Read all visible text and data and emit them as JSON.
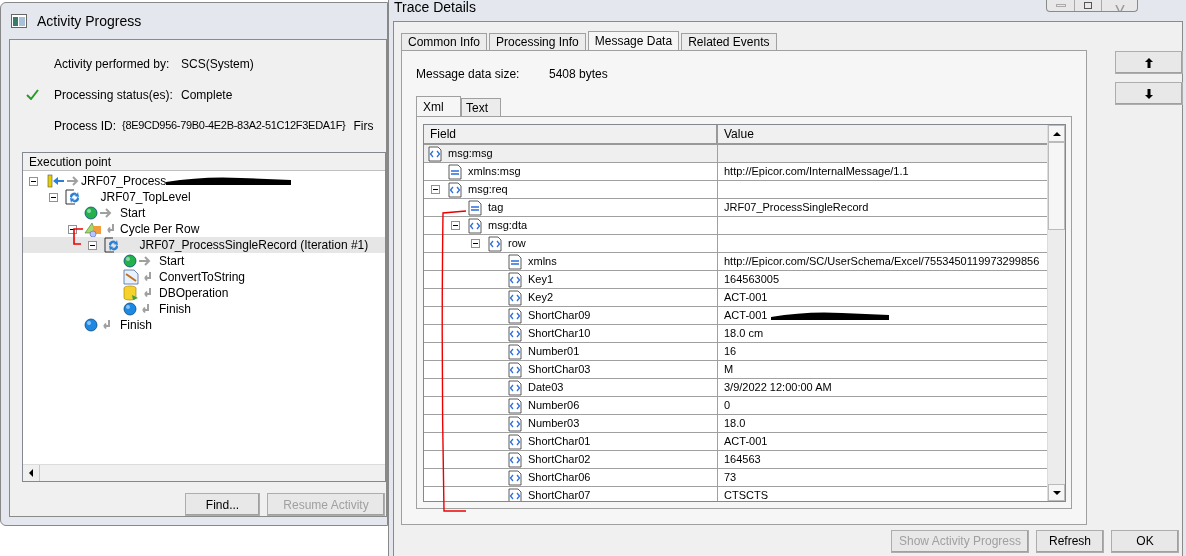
{
  "activity_window": {
    "title": "Activity Progress",
    "fields": [
      {
        "label": "Activity performed by:",
        "value": "SCS(System)",
        "ok": false
      },
      {
        "label": "Processing status(es):",
        "value": "Complete",
        "ok": true
      },
      {
        "label": "Process ID:",
        "value": "{8E9CD956-79B0-4E2B-83A2-51C12F3EDA1F}",
        "ok": false,
        "extra": "Firs"
      }
    ],
    "tree": {
      "header": "Execution point",
      "items": [
        {
          "label": "JRF07_Process",
          "kind": "root",
          "selected": false,
          "redacted": true,
          "expanded": true,
          "children": [
            {
              "label": "JRF07_TopLevel",
              "kind": "process",
              "selected": false,
              "redacted": false,
              "expanded": true,
              "children": [
                {
                  "label": "Start",
                  "kind": "start",
                  "selected": false,
                  "redacted": false
                },
                {
                  "label": "Cycle Per Row",
                  "kind": "loop",
                  "selected": false,
                  "redacted": false,
                  "expanded": true,
                  "children": [
                    {
                      "label": "JRF07_ProcessSingleRecord (Iteration #1)",
                      "kind": "process",
                      "selected": true,
                      "redacted": false,
                      "expanded": true,
                      "children": [
                        {
                          "label": "Start",
                          "kind": "start",
                          "selected": false,
                          "redacted": false
                        },
                        {
                          "label": "ConvertToString",
                          "kind": "convert",
                          "selected": false,
                          "redacted": false
                        },
                        {
                          "label": "DBOperation",
                          "kind": "db",
                          "selected": false,
                          "redacted": false
                        },
                        {
                          "label": "Finish",
                          "kind": "finish",
                          "selected": false,
                          "redacted": false
                        }
                      ]
                    }
                  ]
                },
                {
                  "label": "Finish",
                  "kind": "finish",
                  "selected": false,
                  "redacted": false
                }
              ]
            }
          ]
        }
      ]
    },
    "buttons": [
      {
        "label": "Find...",
        "disabled": false
      },
      {
        "label": "Resume Activity",
        "disabled": true
      }
    ]
  },
  "trace_window": {
    "title": "Trace Details",
    "tabs": [
      {
        "label": "Common Info",
        "selected": false
      },
      {
        "label": "Processing Info",
        "selected": false
      },
      {
        "label": "Message Data",
        "selected": true
      },
      {
        "label": "Related Events",
        "selected": false
      }
    ],
    "size_label": "Message data size:",
    "size_value": "5408 bytes",
    "sub_tabs": [
      {
        "label": "Xml",
        "selected": true
      },
      {
        "label": "Text",
        "selected": false
      }
    ],
    "columns": [
      "Field",
      "Value"
    ],
    "rows": [
      {
        "field": "msg:msg",
        "kind": "element",
        "selected": true,
        "redacted": false,
        "children": [
          {
            "field": "xmlns:msg",
            "kind": "attribute",
            "value": "http://Epicor.com/InternalMessage/1.1",
            "selected": false,
            "redacted": false
          },
          {
            "field": "msg:req",
            "kind": "element",
            "selected": false,
            "redacted": false,
            "expanded": true,
            "children": [
              {
                "field": "tag",
                "kind": "attribute",
                "value": "JRF07_ProcessSingleRecord",
                "selected": false,
                "redacted": false
              },
              {
                "field": "msg:dta",
                "kind": "element",
                "selected": false,
                "redacted": false,
                "expanded": true,
                "children": [
                  {
                    "field": "row",
                    "kind": "element",
                    "selected": false,
                    "redacted": false,
                    "expanded": true,
                    "children": [
                      {
                        "field": "xmlns",
                        "kind": "attribute",
                        "value": "http://Epicor.com/SC/UserSchema/Excel/7553450119973299856",
                        "selected": false,
                        "redacted": false
                      },
                      {
                        "field": "Key1",
                        "kind": "element",
                        "value": "164563005",
                        "selected": false,
                        "redacted": false
                      },
                      {
                        "field": "Key2",
                        "kind": "element",
                        "value": "ACT-001",
                        "selected": false,
                        "redacted": false
                      },
                      {
                        "field": "ShortChar09",
                        "kind": "element",
                        "value": "ACT-001",
                        "selected": false,
                        "redacted": true
                      },
                      {
                        "field": "ShortChar10",
                        "kind": "element",
                        "value": "18.0 cm",
                        "selected": false,
                        "redacted": false
                      },
                      {
                        "field": "Number01",
                        "kind": "element",
                        "value": "16",
                        "selected": false,
                        "redacted": false
                      },
                      {
                        "field": "ShortChar03",
                        "kind": "element",
                        "value": "M",
                        "selected": false,
                        "redacted": false
                      },
                      {
                        "field": "Date03",
                        "kind": "element",
                        "value": "3/9/2022 12:00:00 AM",
                        "selected": false,
                        "redacted": false
                      },
                      {
                        "field": "Number06",
                        "kind": "element",
                        "value": "0",
                        "selected": false,
                        "redacted": false
                      },
                      {
                        "field": "Number03",
                        "kind": "element",
                        "value": "18.0",
                        "selected": false,
                        "redacted": false
                      },
                      {
                        "field": "ShortChar01",
                        "kind": "element",
                        "value": "ACT-001",
                        "selected": false,
                        "redacted": false
                      },
                      {
                        "field": "ShortChar02",
                        "kind": "element",
                        "value": "164563",
                        "selected": false,
                        "redacted": false
                      },
                      {
                        "field": "ShortChar06",
                        "kind": "element",
                        "value": "73",
                        "selected": false,
                        "redacted": false
                      },
                      {
                        "field": "ShortChar07",
                        "kind": "element",
                        "value": "CTSCTS",
                        "selected": false,
                        "redacted": false
                      }
                    ]
                  }
                ]
              }
            ]
          }
        ]
      }
    ],
    "buttons": [
      {
        "label": "Show Activity Progress",
        "disabled": true
      },
      {
        "label": "Refresh",
        "disabled": false
      },
      {
        "label": "OK",
        "disabled": false
      }
    ]
  }
}
